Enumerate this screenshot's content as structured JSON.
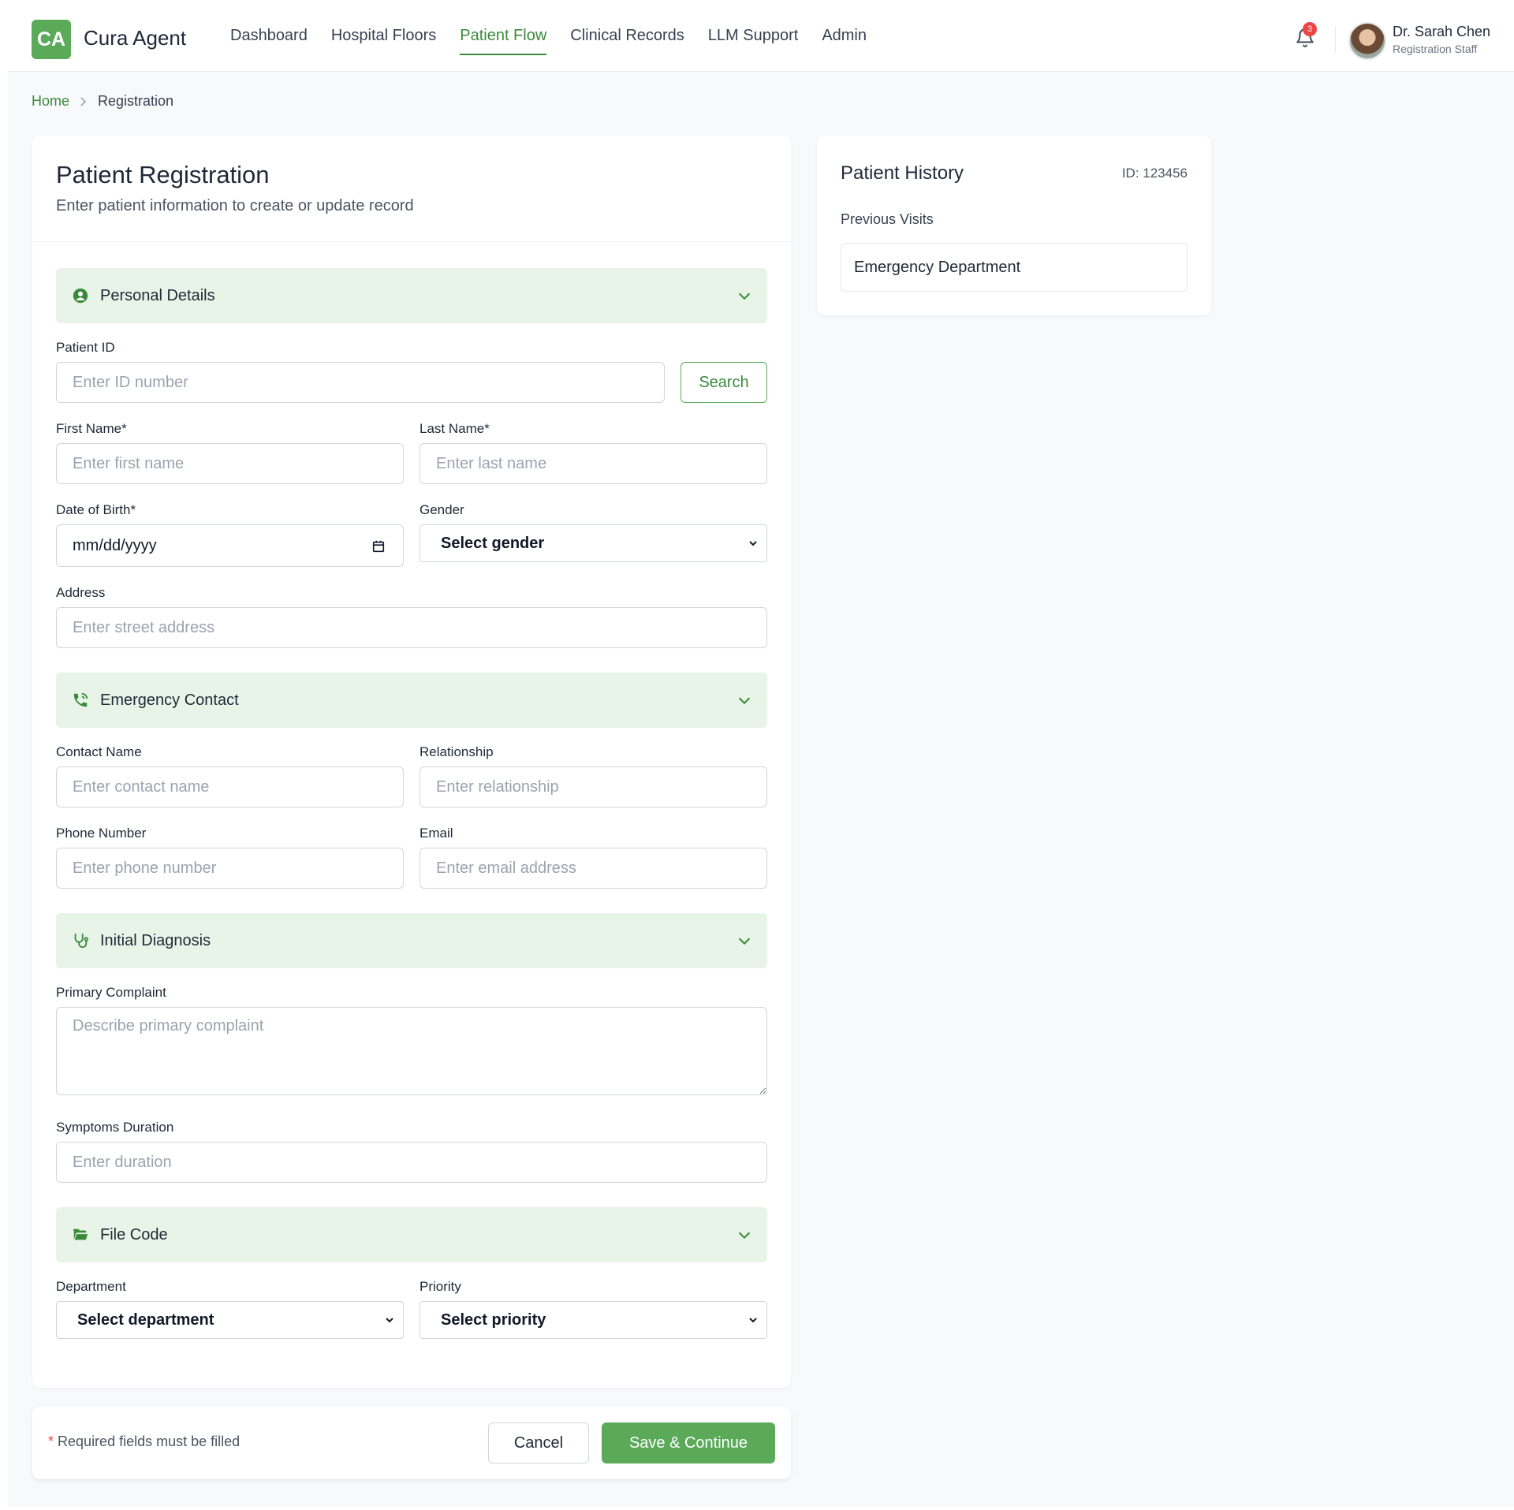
{
  "app": {
    "logo_initials": "CA",
    "name": "Cura Agent"
  },
  "nav": [
    {
      "label": "Dashboard",
      "active": false
    },
    {
      "label": "Hospital Floors",
      "active": false
    },
    {
      "label": "Patient Flow",
      "active": true
    },
    {
      "label": "Clinical Records",
      "active": false
    },
    {
      "label": "LLM Support",
      "active": false
    },
    {
      "label": "Admin",
      "active": false
    }
  ],
  "notifications": {
    "icon": "bell-icon",
    "count": "3"
  },
  "user": {
    "name": "Dr. Sarah Chen",
    "role": "Registration Staff",
    "avatar": "avatar"
  },
  "breadcrumb": {
    "home": "Home",
    "current": "Registration"
  },
  "form": {
    "title": "Patient Registration",
    "subtitle": "Enter patient information to create or update record",
    "sections": {
      "personal": {
        "label": "Personal Details",
        "icon": "user-circle-icon"
      },
      "emergency": {
        "label": "Emergency Contact",
        "icon": "phone-icon"
      },
      "diagnosis": {
        "label": "Initial Diagnosis",
        "icon": "stethoscope-icon"
      },
      "file": {
        "label": "File Code",
        "icon": "folder-open-icon"
      }
    },
    "fields": {
      "patient_id": {
        "label": "Patient ID",
        "placeholder": "Enter ID number"
      },
      "search_label": "Search",
      "first_name": {
        "label": "First Name*",
        "placeholder": "Enter first name"
      },
      "last_name": {
        "label": "Last Name*",
        "placeholder": "Enter last name"
      },
      "dob": {
        "label": "Date of Birth*",
        "value": "mm/dd/yyyy"
      },
      "gender": {
        "label": "Gender",
        "value": "Select gender"
      },
      "address": {
        "label": "Address",
        "placeholder": "Enter street address"
      },
      "contact_name": {
        "label": "Contact Name",
        "placeholder": "Enter contact name"
      },
      "relationship": {
        "label": "Relationship",
        "placeholder": "Enter relationship"
      },
      "phone": {
        "label": "Phone Number",
        "placeholder": "Enter phone number"
      },
      "email": {
        "label": "Email",
        "placeholder": "Enter email address"
      },
      "complaint": {
        "label": "Primary Complaint",
        "placeholder": "Describe primary complaint"
      },
      "duration": {
        "label": "Symptoms Duration",
        "placeholder": "Enter duration"
      },
      "department": {
        "label": "Department",
        "value": "Select department"
      },
      "priority": {
        "label": "Priority",
        "value": "Select priority"
      }
    }
  },
  "footer": {
    "required_star": "*",
    "required_note": "Required fields must be filled",
    "cancel_label": "Cancel",
    "save_label": "Save & Continue"
  },
  "history": {
    "title": "Patient History",
    "id_text": "ID: 123456",
    "subtitle": "Previous Visits",
    "visits": [
      "Emergency Department"
    ]
  },
  "colors": {
    "accent": "#5aaa5a",
    "accent_dark": "#3b8a3b",
    "section_bg": "#e7f4e7",
    "badge": "#ef4444"
  }
}
